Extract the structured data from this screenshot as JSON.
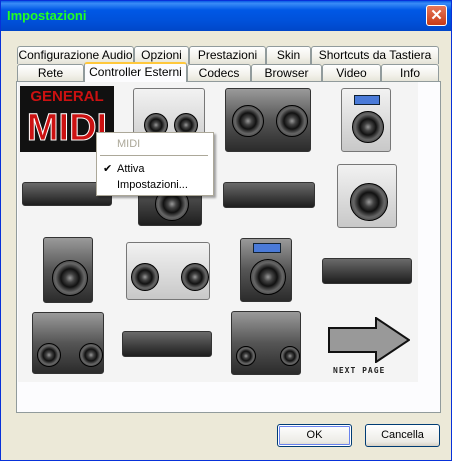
{
  "window": {
    "title": "Impostazioni",
    "close_glyph": "✕"
  },
  "tabs_row1": [
    {
      "label": "Configurazione Audio"
    },
    {
      "label": "Opzioni"
    },
    {
      "label": "Prestazioni"
    },
    {
      "label": "Skin"
    },
    {
      "label": "Shortcuts da Tastiera"
    }
  ],
  "tabs_row2": [
    {
      "label": "Rete"
    },
    {
      "label": "Controller Esterni",
      "active": true
    },
    {
      "label": "Codecs"
    },
    {
      "label": "Browser"
    },
    {
      "label": "Video"
    },
    {
      "label": "Info"
    }
  ],
  "midi_logo": {
    "line1": "GENERAL",
    "line2": "MIDI"
  },
  "context_menu": {
    "header": "MIDI",
    "items": [
      {
        "label": "Attiva",
        "checked": true
      },
      {
        "label": "Impostazioni..."
      }
    ]
  },
  "next_page": {
    "label": "NEXT PAGE"
  },
  "buttons": {
    "ok": "OK",
    "cancel": "Cancella"
  },
  "colors": {
    "title_text": "#22ff22",
    "titlebar": "#0050d8",
    "midi_red": "#cc1111"
  }
}
